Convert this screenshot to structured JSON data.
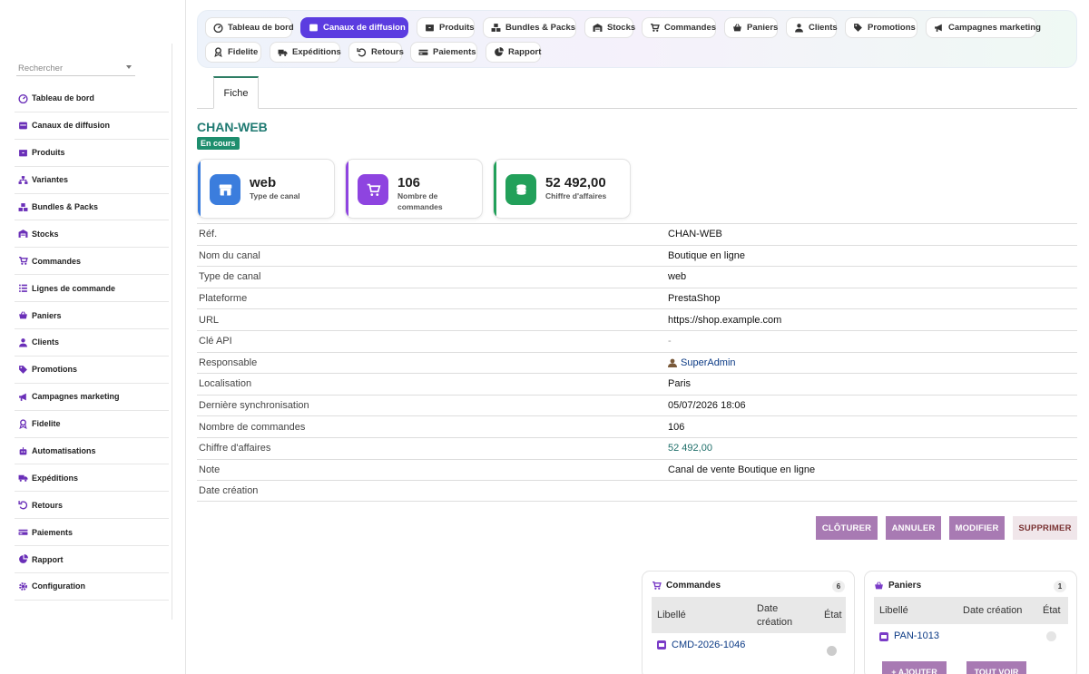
{
  "sidebar": {
    "search_placeholder": "Rechercher",
    "items": [
      {
        "label": "Tableau de bord",
        "icon": "gauge-icon"
      },
      {
        "label": "Canaux de diffusion",
        "icon": "channel-icon"
      },
      {
        "label": "Produits",
        "icon": "box-icon"
      },
      {
        "label": "Variantes",
        "icon": "sitemap-icon"
      },
      {
        "label": "Bundles & Packs",
        "icon": "cubes-icon"
      },
      {
        "label": "Stocks",
        "icon": "warehouse-icon"
      },
      {
        "label": "Commandes",
        "icon": "cart-icon"
      },
      {
        "label": "Lignes de commande",
        "icon": "list-icon"
      },
      {
        "label": "Paniers",
        "icon": "basket-icon"
      },
      {
        "label": "Clients",
        "icon": "user-icon"
      },
      {
        "label": "Promotions",
        "icon": "tags-icon"
      },
      {
        "label": "Campagnes marketing",
        "icon": "bullhorn-icon"
      },
      {
        "label": "Fidelite",
        "icon": "award-icon"
      },
      {
        "label": "Automatisations",
        "icon": "robot-icon"
      },
      {
        "label": "Expéditions",
        "icon": "truck-icon"
      },
      {
        "label": "Retours",
        "icon": "undo-icon"
      },
      {
        "label": "Paiements",
        "icon": "money-icon"
      },
      {
        "label": "Rapport",
        "icon": "chart-pie-icon"
      },
      {
        "label": "Configuration",
        "icon": "gear-icon"
      }
    ]
  },
  "topnav": {
    "items": [
      {
        "label": "Tableau de bord",
        "icon": "gauge-icon"
      },
      {
        "label": "Canaux de diffusion",
        "icon": "channel-icon",
        "active": true
      },
      {
        "label": "Produits",
        "icon": "box-icon"
      },
      {
        "label": "Bundles & Packs",
        "icon": "cubes-icon"
      },
      {
        "label": "Stocks",
        "icon": "warehouse-icon"
      },
      {
        "label": "Commandes",
        "icon": "cart-icon"
      },
      {
        "label": "Paniers",
        "icon": "basket-icon"
      },
      {
        "label": "Clients",
        "icon": "user-icon"
      },
      {
        "label": "Promotions",
        "icon": "tags-icon"
      },
      {
        "label": "Campagnes marketing",
        "icon": "bullhorn-icon"
      },
      {
        "label": "Fidelite",
        "icon": "award-icon"
      },
      {
        "label": "Expéditions",
        "icon": "truck-icon"
      },
      {
        "label": "Retours",
        "icon": "undo-icon"
      },
      {
        "label": "Paiements",
        "icon": "money-icon"
      },
      {
        "label": "Rapport",
        "icon": "chart-pie-icon"
      }
    ],
    "accent": "#5b3ce0"
  },
  "tabs": {
    "fiche": "Fiche"
  },
  "record": {
    "ref": "CHAN-WEB",
    "status": "En cours",
    "status_color": "#1e8e6e"
  },
  "cards": [
    {
      "value": "web",
      "label": "Type de canal",
      "icon": "store-icon",
      "color": "#3b7ddd"
    },
    {
      "value": "106",
      "label": "Nombre de commandes",
      "icon": "cart-icon",
      "color": "#8e44e0"
    },
    {
      "value": "52 492,00",
      "label": "Chiffre d'affaires",
      "icon": "coins-icon",
      "color": "#22a05a"
    }
  ],
  "fields": [
    {
      "key": "Réf.",
      "value": "CHAN-WEB"
    },
    {
      "key": "Nom du canal",
      "value": "Boutique en ligne"
    },
    {
      "key": "Type de canal",
      "value": "web"
    },
    {
      "key": "Plateforme",
      "value": "PrestaShop"
    },
    {
      "key": "URL",
      "value": "https://shop.example.com"
    },
    {
      "key": "Clé API",
      "value": "-"
    },
    {
      "key": "Responsable",
      "value": "SuperAdmin"
    },
    {
      "key": "Localisation",
      "value": "Paris"
    },
    {
      "key": "Dernière synchronisation",
      "value": "05/07/2026 18:06"
    },
    {
      "key": "Nombre de commandes",
      "value": "106"
    },
    {
      "key": "Chiffre d'affaires",
      "value": "52 492,00"
    },
    {
      "key": "Note",
      "value": "Canal de vente Boutique en ligne"
    },
    {
      "key": "Date création",
      "value": ""
    }
  ],
  "actions": {
    "close": "CLÔTURER",
    "cancel": "ANNULER",
    "edit": "MODIFIER",
    "delete": "SUPPRIMER"
  },
  "orders_box": {
    "title": "Commandes",
    "count": "6",
    "col_label": "Libellé",
    "col_date": "Date création",
    "col_state": "État",
    "row_label": "CMD-2026-1046"
  },
  "carts_box": {
    "title": "Paniers",
    "count": "1",
    "col_label": "Libellé",
    "col_date": "Date création",
    "col_state": "État",
    "row_label": "PAN-1013",
    "add_btn": "+ AJOUTER",
    "all_btn": "TOUT VOIR"
  }
}
